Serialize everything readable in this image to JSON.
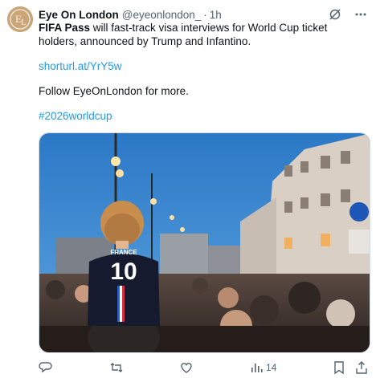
{
  "tweet": {
    "author_name": "Eye On London",
    "author_handle": "@eyeonlondon_",
    "separator": "·",
    "time": "1h",
    "lead_bold": "FIFA Pass",
    "lead_rest": " will fast-track visa interviews for World Cup ticket holders, announced by Trump and Infantino.",
    "link": "shorturl.at/YrY5w",
    "follow_text": "Follow EyeOnLondon for more.",
    "hashtag": "#2026worldcup",
    "image": {
      "jersey_name": "FRANCE",
      "jersey_number": "10"
    }
  },
  "actions": {
    "reply_icon": "reply-icon",
    "retweet_icon": "retweet-icon",
    "like_icon": "heart-icon",
    "views_icon": "views-chart-icon",
    "views_count": "14",
    "bookmark_icon": "bookmark-icon",
    "share_icon": "share-icon"
  },
  "colors": {
    "link": "#1d9bf0",
    "text": "#0f1419",
    "muted": "#536471"
  }
}
